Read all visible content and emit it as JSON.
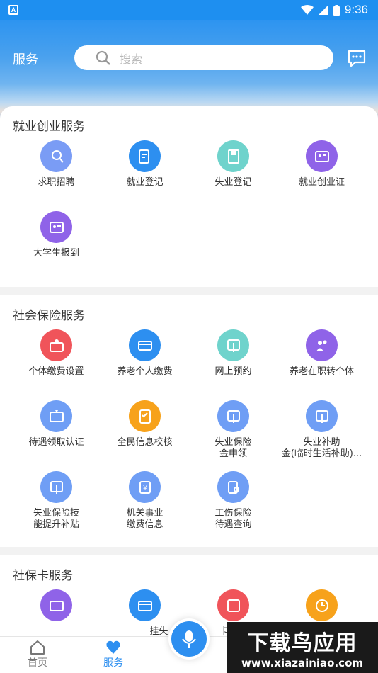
{
  "status": {
    "time": "9:36",
    "badge": "A"
  },
  "header": {
    "title": "服务",
    "search_placeholder": "搜索"
  },
  "sections": [
    {
      "title": "就业创业服务",
      "items": [
        {
          "label": "求职招聘",
          "color": "#7a9cf5"
        },
        {
          "label": "就业登记",
          "color": "#2d8ff0"
        },
        {
          "label": "失业登记",
          "color": "#6fd3cc"
        },
        {
          "label": "就业创业证",
          "color": "#8f63e8"
        },
        {
          "label": "大学生报到",
          "color": "#8f63e8"
        }
      ]
    },
    {
      "title": "社会保险服务",
      "items": [
        {
          "label": "个体缴费设置",
          "color": "#f0545a"
        },
        {
          "label": "养老个人缴费",
          "color": "#2d8ff0"
        },
        {
          "label": "网上预约",
          "color": "#6fd3cc"
        },
        {
          "label": "养老在职转个体",
          "color": "#8f63e8"
        },
        {
          "label": "待遇领取认证",
          "color": "#6f9ef5"
        },
        {
          "label": "全民信息校核",
          "color": "#f7a21b"
        },
        {
          "label": "失业保险\n金申领",
          "color": "#6f9ef5"
        },
        {
          "label": "失业补助\n金(临时生活补助)...",
          "color": "#6f9ef5"
        },
        {
          "label": "失业保险技\n能提升补贴",
          "color": "#6f9ef5"
        },
        {
          "label": "机关事业\n缴费信息",
          "color": "#6f9ef5"
        },
        {
          "label": "工伤保险\n待遇查询",
          "color": "#6f9ef5"
        }
      ]
    },
    {
      "title": "社保卡服务",
      "items": [
        {
          "label": "",
          "color": "#8f63e8"
        },
        {
          "label": "挂失",
          "color": "#2d8ff0"
        },
        {
          "label": "卡",
          "color": "#f0545a"
        },
        {
          "label": "",
          "color": "#f7a21b"
        }
      ]
    }
  ],
  "nav": {
    "home": "首页",
    "service": "服务"
  },
  "watermark": {
    "line1": "下载鸟应用",
    "line2": "www.xiazainiao.com"
  }
}
